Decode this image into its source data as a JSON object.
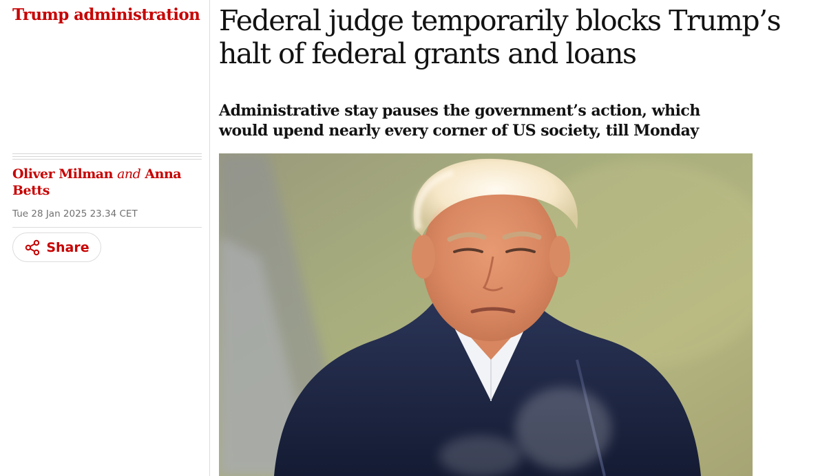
{
  "section": {
    "label": "Trump administration"
  },
  "article": {
    "headline": "Federal judge temporarily blocks Trump’s halt of federal grants and loans",
    "standfirst": "Administrative stay pauses the government’s action, which would upend nearly every corner of US society, till Monday"
  },
  "byline": {
    "author1": "Oliver Milman",
    "conjunction": "and",
    "author2": "Anna Betts",
    "dateline": "Tue 28 Jan 2025 23.34 CET"
  },
  "share": {
    "label": "Share",
    "icon": "share-icon"
  },
  "colors": {
    "accent": "#c70000",
    "text": "#121212",
    "muted": "#707070",
    "rule": "#dcdcdc"
  }
}
